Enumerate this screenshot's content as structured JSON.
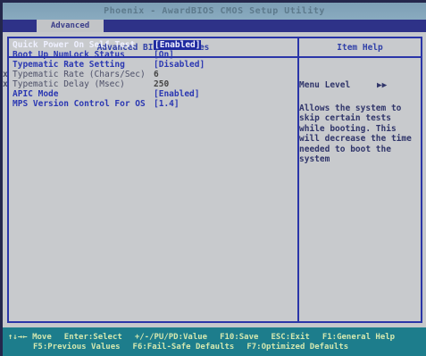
{
  "header": {
    "title": "Phoenix - AwardBIOS CMOS Setup Utility"
  },
  "menubar": {
    "active_tab": "Advanced"
  },
  "panel": {
    "title": "Advanced BIOS Features",
    "help_title": "Item Help"
  },
  "settings": [
    {
      "label": "Quick Power On Self Test",
      "value": "[Enabled]",
      "state": "active",
      "marker": ""
    },
    {
      "label": "Boot Up NumLock Status",
      "value": "[On]",
      "state": "normal",
      "marker": ""
    },
    {
      "label": "Typematic Rate Setting",
      "value": "[Disabled]",
      "state": "normal",
      "marker": ""
    },
    {
      "label": "Typematic Rate (Chars/Sec)",
      "value": "6",
      "state": "grey",
      "marker": "x"
    },
    {
      "label": "Typematic Delay (Msec)",
      "value": "250",
      "state": "grey",
      "marker": "x"
    },
    {
      "label": "APIC Mode",
      "value": "[Enabled]",
      "state": "normal",
      "marker": ""
    },
    {
      "label": "MPS Version Control For OS",
      "value": "[1.4]",
      "state": "normal",
      "marker": ""
    }
  ],
  "help": {
    "menu_level_label": "Menu Level",
    "menu_level_value": "▶▶",
    "lines": [
      "Allows the system to",
      "skip certain tests",
      "while booting. This",
      "will decrease the time",
      "needed to boot the",
      "system"
    ]
  },
  "footer": {
    "line1": [
      "↑↓→← Move",
      "Enter:Select",
      "+/-/PU/PD:Value",
      "F10:Save",
      "ESC:Exit",
      "F1:General Help"
    ],
    "line2": [
      "F5:Previous Values",
      "F6:Fail-Safe Defaults",
      "F7:Optimized Defaults"
    ]
  },
  "colors": {
    "selection": "#1f2aa0",
    "menubar": "#2e3288",
    "footer": "#1d7d8c",
    "label_blue": "#2b38b2"
  }
}
